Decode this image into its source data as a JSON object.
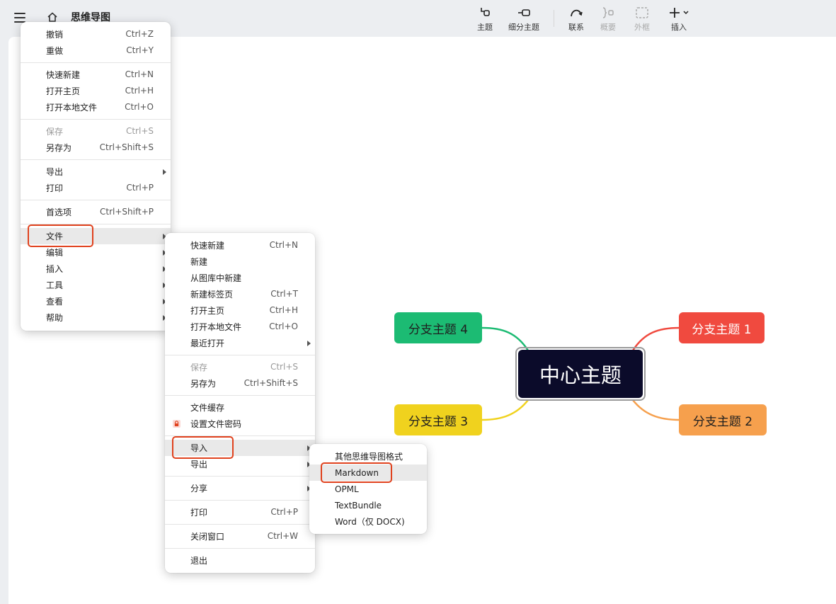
{
  "app": {
    "title": "思维导图"
  },
  "toolbar": {
    "topic": "主题",
    "subtopic": "细分主题",
    "relationship": "联系",
    "summary": "概要",
    "boundary": "外框",
    "insert": "插入"
  },
  "mindmap": {
    "central": "中心主题",
    "branches": [
      {
        "label": "分支主题 1",
        "color": "#f04a3f"
      },
      {
        "label": "分支主题 2",
        "color": "#f6a04d"
      },
      {
        "label": "分支主题 3",
        "color": "#f0d21e"
      },
      {
        "label": "分支主题 4",
        "color": "#1cbb73"
      }
    ],
    "central_color": "#0b0b2a"
  },
  "main_menu": {
    "undo": {
      "label": "撤销",
      "shortcut": "Ctrl+Z"
    },
    "redo": {
      "label": "重做",
      "shortcut": "Ctrl+Y"
    },
    "quick_new": {
      "label": "快速新建",
      "shortcut": "Ctrl+N"
    },
    "open_home": {
      "label": "打开主页",
      "shortcut": "Ctrl+H"
    },
    "open_local": {
      "label": "打开本地文件",
      "shortcut": "Ctrl+O"
    },
    "save": {
      "label": "保存",
      "shortcut": "Ctrl+S"
    },
    "save_as": {
      "label": "另存为",
      "shortcut": "Ctrl+Shift+S"
    },
    "export": {
      "label": "导出"
    },
    "print": {
      "label": "打印",
      "shortcut": "Ctrl+P"
    },
    "preferences": {
      "label": "首选项",
      "shortcut": "Ctrl+Shift+P"
    },
    "file": {
      "label": "文件"
    },
    "edit": {
      "label": "编辑"
    },
    "insert": {
      "label": "插入"
    },
    "tools": {
      "label": "工具"
    },
    "view": {
      "label": "查看"
    },
    "help": {
      "label": "帮助"
    }
  },
  "file_menu": {
    "quick_new": {
      "label": "快速新建",
      "shortcut": "Ctrl+N"
    },
    "new": {
      "label": "新建"
    },
    "new_from_gallery": {
      "label": "从图库中新建"
    },
    "new_tab": {
      "label": "新建标签页",
      "shortcut": "Ctrl+T"
    },
    "open_home": {
      "label": "打开主页",
      "shortcut": "Ctrl+H"
    },
    "open_local": {
      "label": "打开本地文件",
      "shortcut": "Ctrl+O"
    },
    "recent": {
      "label": "最近打开"
    },
    "save": {
      "label": "保存",
      "shortcut": "Ctrl+S"
    },
    "save_as": {
      "label": "另存为",
      "shortcut": "Ctrl+Shift+S"
    },
    "file_cache": {
      "label": "文件缓存"
    },
    "set_password": {
      "label": "设置文件密码"
    },
    "import": {
      "label": "导入"
    },
    "export": {
      "label": "导出"
    },
    "share": {
      "label": "分享"
    },
    "print": {
      "label": "打印",
      "shortcut": "Ctrl+P"
    },
    "close_window": {
      "label": "关闭窗口",
      "shortcut": "Ctrl+W"
    },
    "quit": {
      "label": "退出"
    }
  },
  "import_menu": {
    "other_formats": "其他思维导图格式",
    "markdown": "Markdown",
    "opml": "OPML",
    "textbundle": "TextBundle",
    "word": "Word（仅 DOCX)"
  },
  "colors": {
    "highlight_box": "#e0421e",
    "menu_hover": "#e9e9e9"
  }
}
